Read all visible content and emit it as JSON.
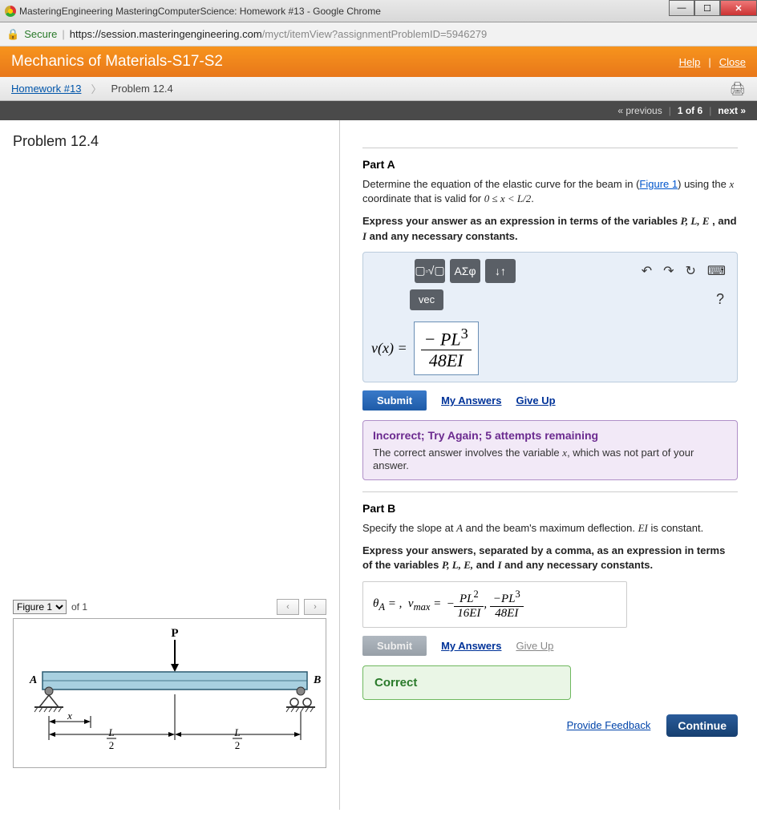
{
  "window": {
    "title": "MasteringEngineering MasteringComputerScience: Homework #13 - Google Chrome",
    "secure_label": "Secure",
    "url_domain": "https://session.masteringengineering.com",
    "url_path": "/myct/itemView?assignmentProblemID=5946279"
  },
  "course_bar": {
    "title": "Mechanics of Materials-S17-S2",
    "help": "Help",
    "close": "Close"
  },
  "breadcrumb": {
    "homework": "Homework #13",
    "problem": "Problem 12.4"
  },
  "nav": {
    "previous": "« previous",
    "position": "1 of 6",
    "next": "next »"
  },
  "problem_title": "Problem 12.4",
  "figure": {
    "select_label": "Figure 1",
    "of_text": "of 1",
    "labels": {
      "P": "P",
      "A": "A",
      "B": "B",
      "x": "x",
      "Lhalf1": "L",
      "Lhalf1d": "2",
      "Lhalf2": "L",
      "Lhalf2d": "2"
    }
  },
  "partA": {
    "heading": "Part A",
    "text1a": "Determine the equation of the elastic curve for the beam in (",
    "figure_link": "Figure 1",
    "text1b": ") using the ",
    "var_x": "x",
    "text1c": " coordinate that is valid for ",
    "range": "0 ≤ x < L/2",
    "text1d": ".",
    "text2a": "Express your answer as an expression in terms of the variables ",
    "vars": "P, L, E",
    "text2b": " , and ",
    "var_I": "I",
    "text2c": " and any necessary constants.",
    "toolbar": {
      "greek": "ΑΣφ",
      "updown": "↓↑",
      "vec": "vec"
    },
    "prefix": "v(x) = ",
    "answer_num": "− PL",
    "answer_exp": "3",
    "answer_den": "48EI",
    "submit": "Submit",
    "my_answers": "My Answers",
    "give_up": "Give Up",
    "feedback_title": "Incorrect; Try Again; 5 attempts remaining",
    "feedback_msg_a": "The correct answer involves the variable ",
    "feedback_var": "x",
    "feedback_msg_b": ", which was not part of your answer."
  },
  "partB": {
    "heading": "Part B",
    "text1a": "Specify the slope at ",
    "var_A": "A",
    "text1b": " and the beam's maximum deflection. ",
    "var_EI": "EI",
    "text1c": " is constant.",
    "text2a": "Express your answers, separated by a comma, as an expression in terms of the variables ",
    "vars": "P, L, E,",
    "text2b": " and ",
    "var_I": "I",
    "text2c": " and any necessary constants.",
    "prefix": "θ_A = ,  v_max = ",
    "ans_num1": "PL",
    "ans_exp1": "2",
    "ans_den1": "16EI",
    "comma": ",",
    "ans_num2": "−PL",
    "ans_exp2": "3",
    "ans_den2": "48EI",
    "submit": "Submit",
    "my_answers": "My Answers",
    "give_up": "Give Up",
    "feedback": "Correct"
  },
  "footer": {
    "provide_feedback": "Provide Feedback",
    "continue": "Continue"
  }
}
